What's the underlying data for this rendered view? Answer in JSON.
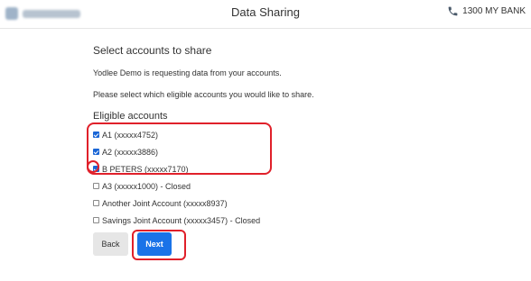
{
  "header": {
    "title": "Data Sharing",
    "phone": "1300 MY BANK",
    "phone_icon": "phone-icon",
    "logo_icon": "bank-logo-icon"
  },
  "main": {
    "section_title": "Select accounts to share",
    "request_text": "Yodlee Demo is requesting data from your accounts.",
    "instruction_text": "Please select which eligible accounts you would like to share.",
    "eligible_label": "Eligible accounts",
    "accounts": [
      {
        "label": "A1 (xxxxx4752)",
        "checked": true
      },
      {
        "label": "A2 (xxxxx3886)",
        "checked": true
      },
      {
        "label": "B PETERS (xxxxx7170)",
        "checked": true
      },
      {
        "label": "A3 (xxxxx1000) - Closed",
        "checked": false
      },
      {
        "label": "Another Joint Account (xxxxx8937)",
        "checked": false
      },
      {
        "label": "Savings Joint Account (xxxxx3457) - Closed",
        "checked": false
      }
    ]
  },
  "buttons": {
    "back_label": "Back",
    "next_label": "Next"
  },
  "colors": {
    "accent": "#1a73e8",
    "annotation": "#e0202a"
  }
}
